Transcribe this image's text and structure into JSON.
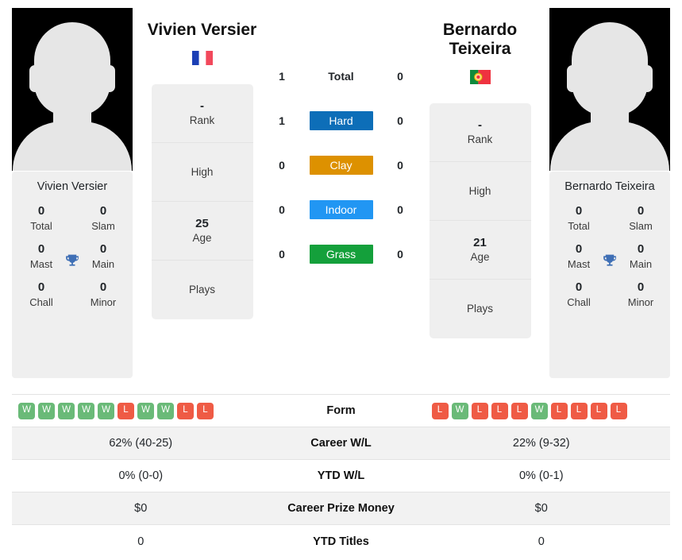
{
  "left_player": {
    "name": "Vivien Versier",
    "photo_caption": "Vivien Versier",
    "flag": "flag-france",
    "titles": {
      "total_value": "0",
      "total_label": "Total",
      "slam_value": "0",
      "slam_label": "Slam",
      "mast_value": "0",
      "mast_label": "Mast",
      "main_value": "0",
      "main_label": "Main",
      "chall_value": "0",
      "chall_label": "Chall",
      "minor_value": "0",
      "minor_label": "Minor"
    },
    "info": {
      "rank_value": "-",
      "rank_label": "Rank",
      "high_value": "",
      "high_label": "High",
      "age_value": "25",
      "age_label": "Age",
      "plays_value": "",
      "plays_label": "Plays"
    },
    "form": [
      "W",
      "W",
      "W",
      "W",
      "W",
      "L",
      "W",
      "W",
      "L",
      "L"
    ],
    "career_wl": "62% (40-25)",
    "ytd_wl": "0% (0-0)",
    "career_prize_money": "$0",
    "ytd_titles": "0"
  },
  "right_player": {
    "name": "Bernardo Teixeira",
    "photo_caption": "Bernardo Teixeira",
    "flag": "flag-portugal",
    "titles": {
      "total_value": "0",
      "total_label": "Total",
      "slam_value": "0",
      "slam_label": "Slam",
      "mast_value": "0",
      "mast_label": "Mast",
      "main_value": "0",
      "main_label": "Main",
      "chall_value": "0",
      "chall_label": "Chall",
      "minor_value": "0",
      "minor_label": "Minor"
    },
    "info": {
      "rank_value": "-",
      "rank_label": "Rank",
      "high_value": "",
      "high_label": "High",
      "age_value": "21",
      "age_label": "Age",
      "plays_value": "",
      "plays_label": "Plays"
    },
    "form": [
      "L",
      "W",
      "L",
      "L",
      "L",
      "W",
      "L",
      "L",
      "L",
      "L"
    ],
    "career_wl": "22% (9-32)",
    "ytd_wl": "0% (0-1)",
    "career_prize_money": "$0",
    "ytd_titles": "0"
  },
  "head_to_head": [
    {
      "label": "Total",
      "left": "1",
      "right": "0",
      "chip": false,
      "color": ""
    },
    {
      "label": "Hard",
      "left": "1",
      "right": "0",
      "chip": true,
      "color": "#0d6eb8"
    },
    {
      "label": "Clay",
      "left": "0",
      "right": "0",
      "chip": true,
      "color": "#dd9100"
    },
    {
      "label": "Indoor",
      "left": "0",
      "right": "0",
      "chip": true,
      "color": "#2196f3"
    },
    {
      "label": "Grass",
      "left": "0",
      "right": "0",
      "chip": true,
      "color": "#14a03b"
    }
  ],
  "table_rows": [
    {
      "label": "Form",
      "key": "form",
      "type": "form"
    },
    {
      "label": "Career W/L",
      "key": "career_wl",
      "type": "text"
    },
    {
      "label": "YTD W/L",
      "key": "ytd_wl",
      "type": "text"
    },
    {
      "label": "Career Prize Money",
      "key": "career_prize_money",
      "type": "text"
    },
    {
      "label": "YTD Titles",
      "key": "ytd_titles",
      "type": "text"
    }
  ],
  "icons": {
    "trophy": "trophy-icon",
    "trophy_glyph": "🏆"
  },
  "colors": {
    "hard": "#0d6eb8",
    "clay": "#dd9100",
    "indoor": "#2196f3",
    "grass": "#14a03b",
    "win": "#6aba78",
    "loss": "#ef5b45",
    "card_bg": "#efefef",
    "row_alt_bg": "#f2f2f2"
  }
}
